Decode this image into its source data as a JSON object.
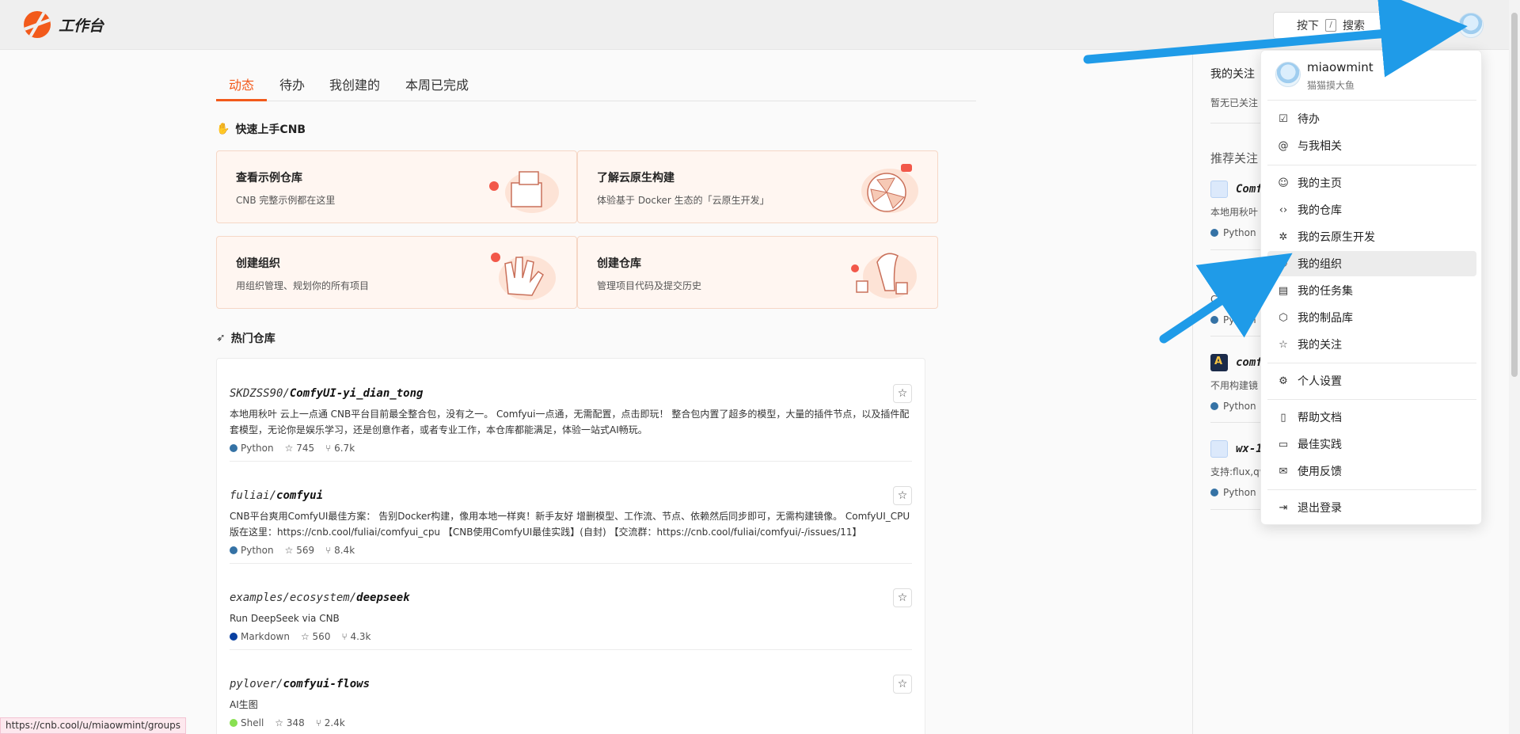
{
  "header": {
    "logo_text": "工作台",
    "search_prefix": "按下",
    "search_key": "/",
    "search_label": "搜索"
  },
  "tabs": [
    "动态",
    "待办",
    "我创建的",
    "本周已完成"
  ],
  "quickstart": {
    "title": "快速上手CNB",
    "cards": [
      {
        "title": "查看示例仓库",
        "desc": "CNB 完整示例都在这里"
      },
      {
        "title": "了解云原生构建",
        "desc": "体验基于 Docker 生态的「云原生开发」"
      },
      {
        "title": "创建组织",
        "desc": "用组织管理、规划你的所有项目"
      },
      {
        "title": "创建仓库",
        "desc": "管理项目代码及提交历史"
      }
    ]
  },
  "hot": {
    "title": "热门仓库",
    "repos": [
      {
        "owner": "SKDZSS90/",
        "name": "ComfyUI-yi_dian_tong",
        "desc": "本地用秋叶 云上一点通 CNB平台目前最全整合包，没有之一。 Comfyui一点通，无需配置，点击即玩！ 整合包内置了超多的模型，大量的插件节点，以及插件配套模型，无论你是娱乐学习，还是创意作者，或者专业工作，本仓库都能满足，体验一站式AI畅玩。",
        "lang": "Python",
        "lang_color": "#3572A5",
        "stars": "745",
        "forks": "6.7k"
      },
      {
        "owner": "fuliai/",
        "name": "comfyui",
        "desc": "CNB平台爽用ComfyUI最佳方案： 告别Docker构建，像用本地一样爽！新手友好 增删模型、工作流、节点、依赖然后同步即可，无需构建镜像。 ComfyUI_CPU版在这里：https://cnb.cool/fuliai/comfyui_cpu 【CNB使用ComfyUI最佳实践】(自封) 【交流群：https://cnb.cool/fuliai/comfyui/-/issues/11】",
        "lang": "Python",
        "lang_color": "#3572A5",
        "stars": "569",
        "forks": "8.4k"
      },
      {
        "owner": "examples/ecosystem/",
        "name": "deepseek",
        "desc": "Run DeepSeek via CNB",
        "lang": "Markdown",
        "lang_color": "#083fa1",
        "stars": "560",
        "forks": "4.3k"
      },
      {
        "owner": "pylover/",
        "name": "comfyui-flows",
        "desc": "AI生图",
        "lang": "Shell",
        "lang_color": "#89e051",
        "stars": "348",
        "forks": "2.4k"
      }
    ]
  },
  "right": {
    "follow_title": "我的关注",
    "follow_empty": "暂无已关注",
    "rec_title": "推荐关注",
    "items": [
      {
        "name": "Comf",
        "desc": "本地用秋叶",
        "lang": "Python"
      },
      {
        "name": "co",
        "desc": "CNB平台爽",
        "lang": "Python"
      },
      {
        "name": "comf",
        "desc": "不用构建镜",
        "lang": "Python"
      },
      {
        "name": "wx-1",
        "desc": "支持:flux,qw",
        "lang": "Python"
      }
    ]
  },
  "menu": {
    "username": "miaowmint",
    "nickname": "猫猫摸大鱼",
    "groups": [
      [
        {
          "icon": "todo-icon",
          "glyph": "☑",
          "label": "待办"
        },
        {
          "icon": "at-icon",
          "glyph": "@",
          "label": "与我相关"
        }
      ],
      [
        {
          "icon": "user-icon",
          "glyph": "☺",
          "label": "我的主页"
        },
        {
          "icon": "code-icon",
          "glyph": "‹›",
          "label": "我的仓库"
        },
        {
          "icon": "cloud-dev-icon",
          "glyph": "✲",
          "label": "我的云原生开发"
        },
        {
          "icon": "group-icon",
          "glyph": "⚇",
          "label": "我的组织"
        },
        {
          "icon": "tasks-icon",
          "glyph": "▤",
          "label": "我的任务集"
        },
        {
          "icon": "package-icon",
          "glyph": "⬡",
          "label": "我的制品库"
        },
        {
          "icon": "star-icon",
          "glyph": "☆",
          "label": "我的关注"
        }
      ],
      [
        {
          "icon": "settings-icon",
          "glyph": "⚙",
          "label": "个人设置"
        }
      ],
      [
        {
          "icon": "doc-icon",
          "glyph": "▯",
          "label": "帮助文档"
        },
        {
          "icon": "book-icon",
          "glyph": "▭",
          "label": "最佳实践"
        },
        {
          "icon": "feedback-icon",
          "glyph": "✉",
          "label": "使用反馈"
        }
      ],
      [
        {
          "icon": "logout-icon",
          "glyph": "⇥",
          "label": "退出登录"
        }
      ]
    ]
  },
  "status_url": "https://cnb.cool/u/miaowmint/groups",
  "colors": {
    "accent": "#f25a1b",
    "arrow": "#1f9be8"
  }
}
